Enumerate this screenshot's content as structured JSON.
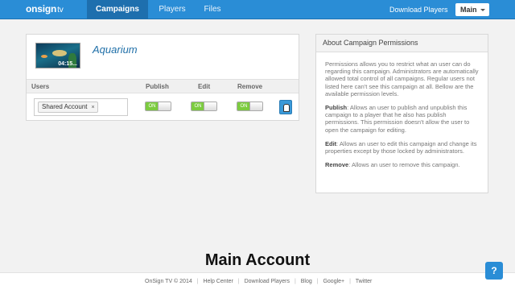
{
  "navbar": {
    "logo_main": "onsign",
    "logo_suffix": "tv",
    "tabs": [
      {
        "label": "Campaigns",
        "active": true
      },
      {
        "label": "Players",
        "active": false
      },
      {
        "label": "Files",
        "active": false
      }
    ],
    "download_link": "Download Players",
    "account_menu": "Main",
    "accent_color": "#2a8dd6"
  },
  "campaign": {
    "title": "Aquarium",
    "thumbnail_time": "04:15...",
    "columns": [
      "Users",
      "Publish",
      "Edit",
      "Remove"
    ],
    "rows": [
      {
        "user": "Shared Account",
        "remove_tag": "×",
        "publish": {
          "label": "ON",
          "enabled": true
        },
        "edit": {
          "label": "ON",
          "enabled": true
        },
        "remove": {
          "label": "ON",
          "enabled": true
        }
      }
    ]
  },
  "about": {
    "title": "About Campaign Permissions",
    "intro": "Permissions allows you to restrict what an user can do regarding this campaign. Administrators are automatically allowed total control of all campaigns. Regular users not listed here can't see this campaign at all. Bellow are the available permission levels.",
    "publish_term": "Publish",
    "publish_desc": ": Allows an user to publish and unpublish this campaign to a player that he also has publish permissions. This permission doesn't allow the user to open the campaign for editing.",
    "edit_term": "Edit",
    "edit_desc": ": Allows an user to edit this campaign and change its properties except by those locked by administrators.",
    "remove_term": "Remove",
    "remove_desc": ": Allows an user to remove this campaign."
  },
  "caption": "Main Account",
  "footer": {
    "copyright": "OnSign TV © 2014",
    "links": [
      "Help Center",
      "Download Players",
      "Blog",
      "Google+",
      "Twitter"
    ],
    "separator": "|"
  },
  "help_button": "?"
}
